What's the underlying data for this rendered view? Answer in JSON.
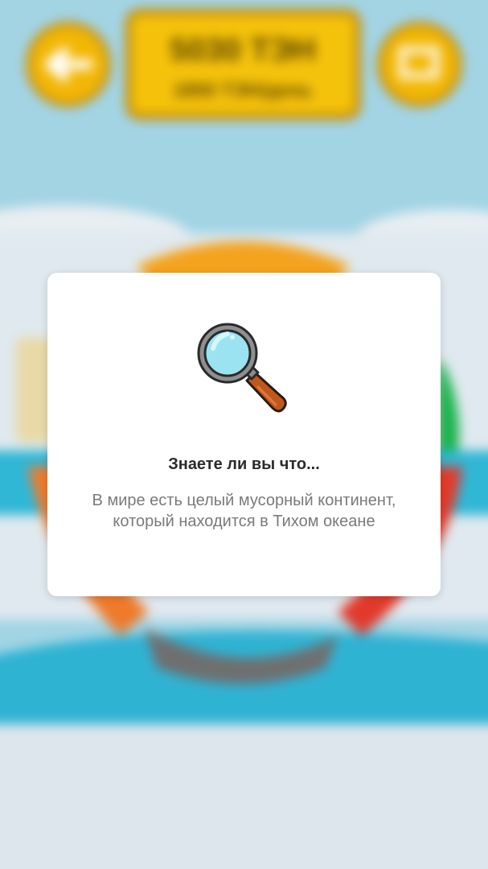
{
  "background_hud": {
    "points_value": "5030 ТЭН",
    "points_sub": "1850 ТЭН/день"
  },
  "dialog": {
    "icon": "magnifier-icon",
    "title": "Знаете ли вы что...",
    "message": "В мире есть целый мусорный континент, который находится в Тихом океане"
  },
  "colors": {
    "sky": "#9fd3e3",
    "modal_bg": "#ffffff",
    "title_text": "#2b2b2b",
    "body_text": "#7a7a7a",
    "magnifier_lens": "#9be3f0",
    "magnifier_handle": "#c0581e"
  }
}
